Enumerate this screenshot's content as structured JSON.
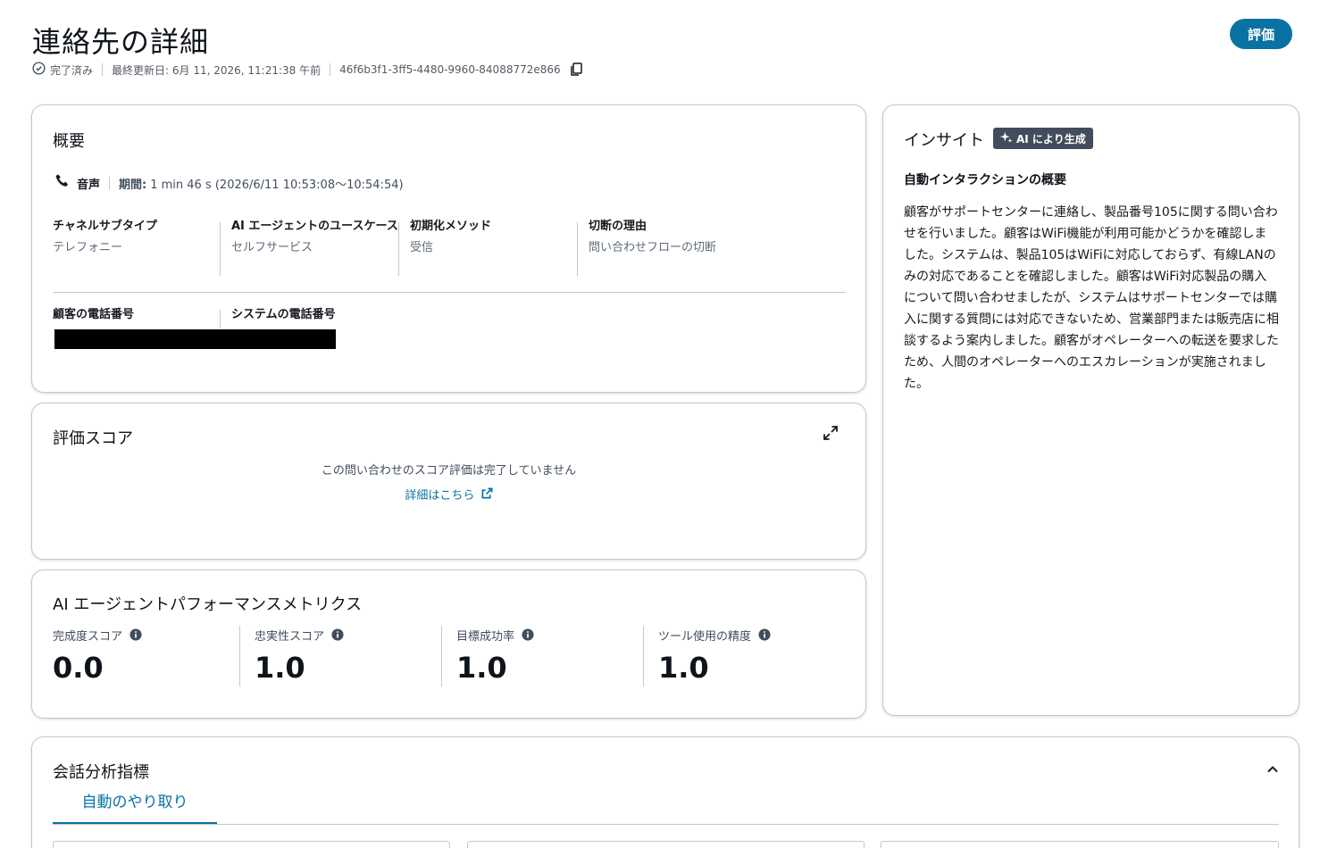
{
  "header": {
    "title": "連絡先の詳細",
    "evaluate_button": "評価",
    "status": "完了済み",
    "last_updated": "最終更新日: 6月 11, 2026, 11:21:38 午前",
    "contact_id": "46f6b3f1-3ff5-4480-9960-84088772e866"
  },
  "overview": {
    "title": "概要",
    "channel": "音声",
    "duration_label": "期間:",
    "duration_value": "1 min 46 s (2026/6/11 10:53:08～10:54:54)",
    "fields": [
      {
        "label": "チャネルサブタイプ",
        "value": "テレフォニー"
      },
      {
        "label": "AI エージェントのユースケース",
        "value": "セルフサービス"
      },
      {
        "label": "初期化メソッド",
        "value": "受信"
      },
      {
        "label": "切断の理由",
        "value": "問い合わせフローの切断"
      }
    ],
    "phone_fields": [
      {
        "label": "顧客の電話番号"
      },
      {
        "label": "システムの電話番号"
      }
    ]
  },
  "score": {
    "title": "評価スコア",
    "message": "この問い合わせのスコア評価は完了していません",
    "link": "詳細はこちら"
  },
  "metrics": {
    "title": "AI エージェントパフォーマンスメトリクス",
    "items": [
      {
        "label": "完成度スコア",
        "value": "0.0"
      },
      {
        "label": "忠実性スコア",
        "value": "1.0"
      },
      {
        "label": "目標成功率",
        "value": "1.0"
      },
      {
        "label": "ツール使用の精度",
        "value": "1.0"
      }
    ]
  },
  "insight": {
    "title": "インサイト",
    "badge": "AI により生成",
    "heading": "自動インタラクションの概要",
    "body": "顧客がサポートセンターに連絡し、製品番号105に関する問い合わせを行いました。顧客はWiFi機能が利用可能かどうかを確認しました。システムは、製品105はWiFiに対応しておらず、有線LANのみの対応であることを確認しました。顧客はWiFi対応製品の購入について問い合わせましたが、システムはサポートセンターでは購入に関する質問には対応できないため、営業部門または販売店に相談するよう案内しました。顧客がオペレーターへの転送を要求したため、人間のオペレーターへのエスカレーションが実施されました。"
  },
  "analytics": {
    "title": "会話分析指標",
    "tab_active": "自動のやり取り"
  },
  "colors": {
    "accent": "#0972a3",
    "border": "#c6c6cd",
    "badge_bg": "#414d5c"
  },
  "icons": [
    "check-circle-icon",
    "copy-icon",
    "phone-icon",
    "expand-icon",
    "external-link-icon",
    "info-icon",
    "sparkle-icon",
    "chevron-up-icon"
  ]
}
